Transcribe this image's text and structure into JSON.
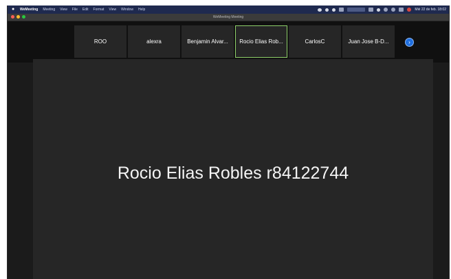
{
  "menubar": {
    "app_name": "WeMeeting",
    "items": [
      "Meeting",
      "View",
      "File",
      "Edit",
      "Format",
      "View",
      "Window",
      "Help"
    ],
    "clock": "Mié 22 de feb. 18:02"
  },
  "window": {
    "title": "WeMeeting Meeting"
  },
  "participants": {
    "tiles": [
      {
        "name": "ROO",
        "active": false
      },
      {
        "name": "alexra",
        "active": false
      },
      {
        "name": "Benjamin Alvar...",
        "active": false
      },
      {
        "name": "Rocio Elias Rob...",
        "active": true
      },
      {
        "name": "CarlosC",
        "active": false
      },
      {
        "name": "Juan Jose B-D...",
        "active": false
      }
    ],
    "next_icon": "›"
  },
  "speaker": {
    "name": "Rocio Elias Robles r84122744"
  },
  "colors": {
    "active_border": "#8fd16a",
    "next_button": "#1f6fe0"
  }
}
